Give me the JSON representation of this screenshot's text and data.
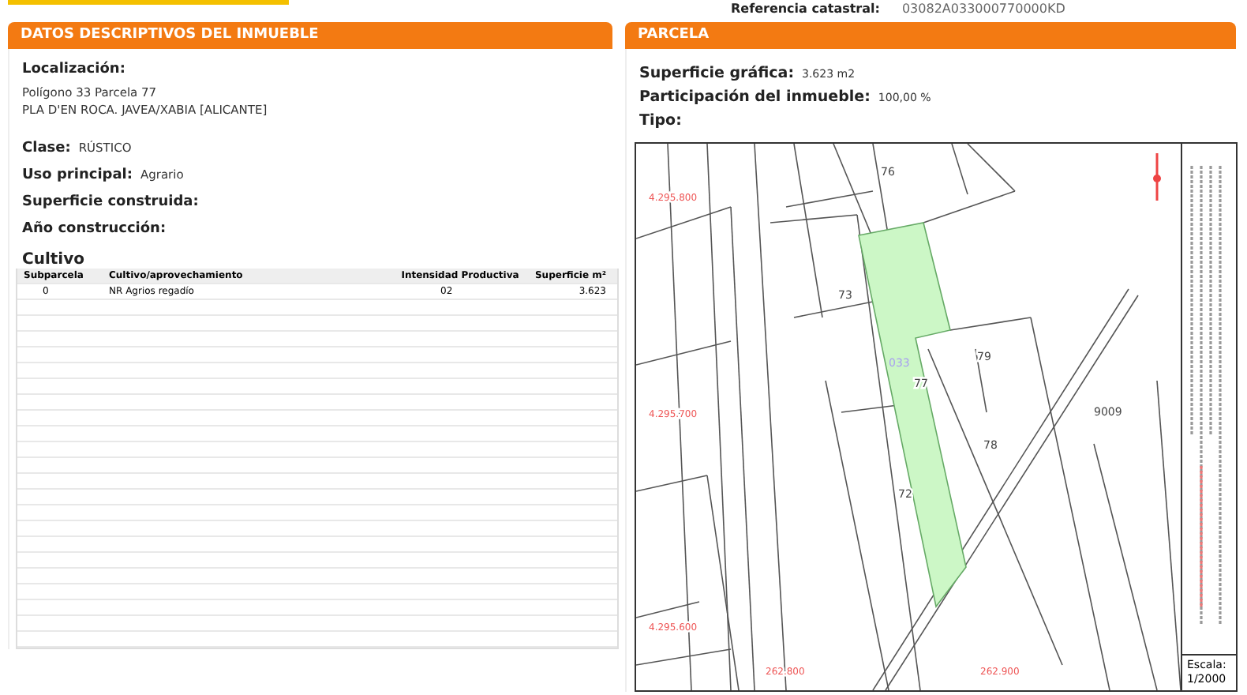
{
  "reference": {
    "label": "Referencia catastral:",
    "value": "03082A033000770000KD"
  },
  "left_panel": {
    "title": "DATOS DESCRIPTIVOS DEL INMUEBLE",
    "location": {
      "label": "Localización:",
      "lines": [
        "Polígono 33 Parcela 77",
        "PLA D'EN ROCA. JAVEA/XABIA [ALICANTE]"
      ]
    },
    "fields": [
      {
        "label": "Clase:",
        "value": "RÚSTICO"
      },
      {
        "label": "Uso principal:",
        "value": "Agrario"
      },
      {
        "label": "Superficie construida:"
      },
      {
        "label": "Año construcción:"
      }
    ],
    "cultivo": {
      "title": "Cultivo",
      "columns": [
        "Subparcela",
        "Cultivo/aprovechamiento",
        "Intensidad Productiva",
        "Superficie m²"
      ],
      "rows": [
        [
          "0",
          "NR Agrios regadío",
          "02",
          "3.623"
        ]
      ]
    }
  },
  "right_panel": {
    "title": "PARCELA",
    "fields": [
      {
        "label": "Superficie gráfica:",
        "value": "3.623 m2"
      },
      {
        "label": "Participación del inmueble:",
        "value": "100,00 %"
      },
      {
        "label": "Tipo:"
      }
    ],
    "map": {
      "parcel_labels": [
        {
          "text": "76",
          "kind": "parcel"
        },
        {
          "text": "73",
          "kind": "parcel"
        },
        {
          "text": "033",
          "kind": "polygon"
        },
        {
          "text": "77",
          "kind": "parcel"
        },
        {
          "text": "79",
          "kind": "parcel"
        },
        {
          "text": "78",
          "kind": "parcel"
        },
        {
          "text": "72",
          "kind": "parcel"
        },
        {
          "text": "9009",
          "kind": "parcel"
        }
      ],
      "y_coords": [
        "4.295.800",
        "4.295.700",
        "4.295.600"
      ],
      "x_coords": [
        "262.800",
        "262.900"
      ],
      "scale_label": "Escala:",
      "scale": "1/2000"
    }
  }
}
